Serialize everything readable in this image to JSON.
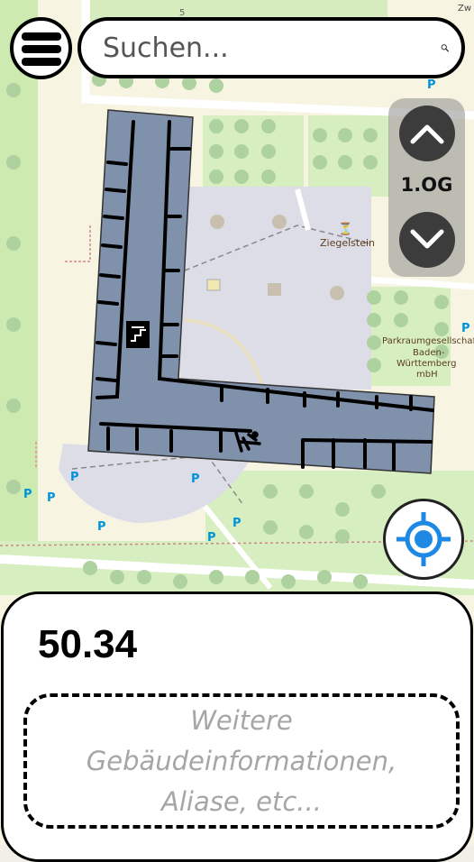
{
  "search": {
    "placeholder": "Suchen..."
  },
  "floor_selector": {
    "current_floor": "1.OG"
  },
  "map": {
    "labels": {
      "ziegelstein": "Ziegelstein",
      "parkraum_1": "Parkraumgesellschaft",
      "parkraum_2": "Baden-",
      "parkraum_3": "Württemberg",
      "parkraum_4": "mbH",
      "house_number": "5",
      "top_right_fragment": "Zw"
    },
    "colors": {
      "building_fill": "#8091ab",
      "courtyard": "#dddde8",
      "park": "#cdebb0",
      "tree": "#aed1a0",
      "parking_icon": "#0092da",
      "locate_accent": "#1e88e5"
    }
  },
  "info_panel": {
    "room_number": "50.34",
    "more_info_line1": "Weitere",
    "more_info_line2": "Gebäudeinformationen,",
    "more_info_line3": "Aliase, etc..."
  },
  "icons": {
    "menu": "hamburger-icon",
    "search": "magnifier-icon",
    "floor_up": "chevron-up-icon",
    "floor_down": "chevron-down-icon",
    "locate": "crosshair-location-icon",
    "stairs": "stairs-icon",
    "restroom": "restroom-icon"
  }
}
